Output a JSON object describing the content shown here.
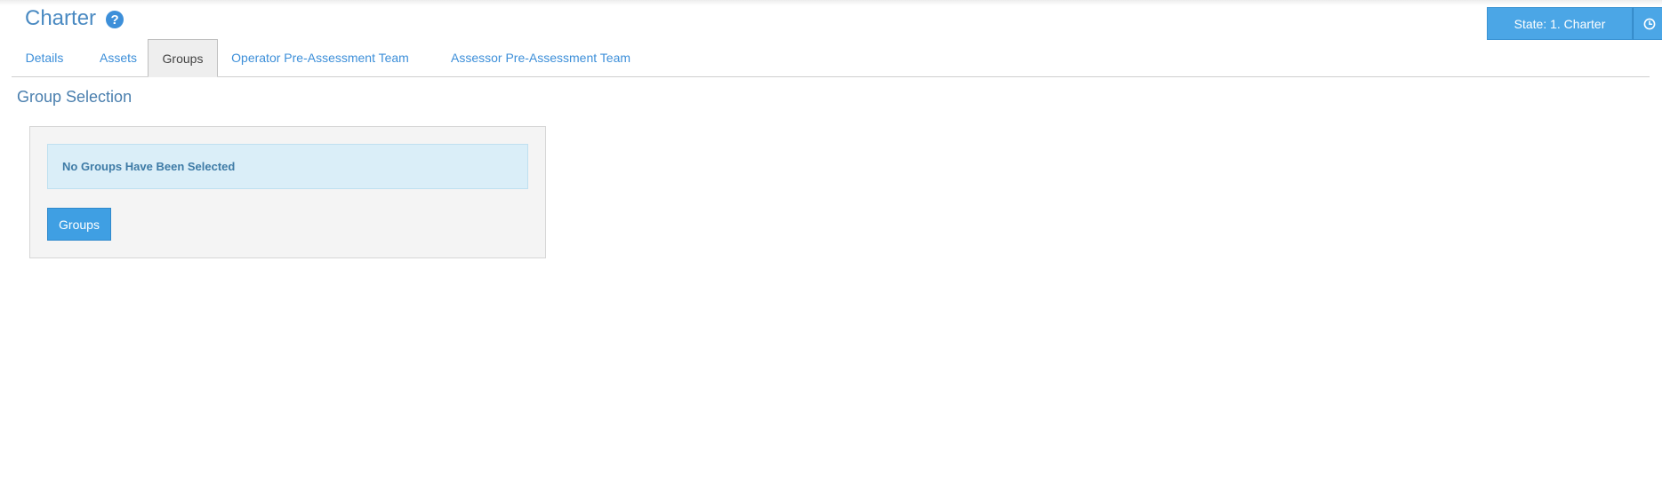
{
  "header": {
    "title": "Charter",
    "help_icon": "question-circle-icon",
    "state_label": "State: 1. Charter",
    "history_icon": "clock-icon"
  },
  "tabs": [
    {
      "label": "Details",
      "active": false
    },
    {
      "label": "Assets",
      "active": false
    },
    {
      "label": "Groups",
      "active": true
    },
    {
      "label": "Operator Pre-Assessment Team",
      "active": false
    },
    {
      "label": "Assessor Pre-Assessment Team",
      "active": false
    }
  ],
  "section": {
    "title": "Group Selection",
    "alert_text": "No Groups Have Been Selected",
    "button_label": "Groups"
  },
  "colors": {
    "accent": "#4ba6e6",
    "link": "#3d8fd9",
    "title": "#4a8ac2",
    "alert_bg": "#daeef8"
  }
}
